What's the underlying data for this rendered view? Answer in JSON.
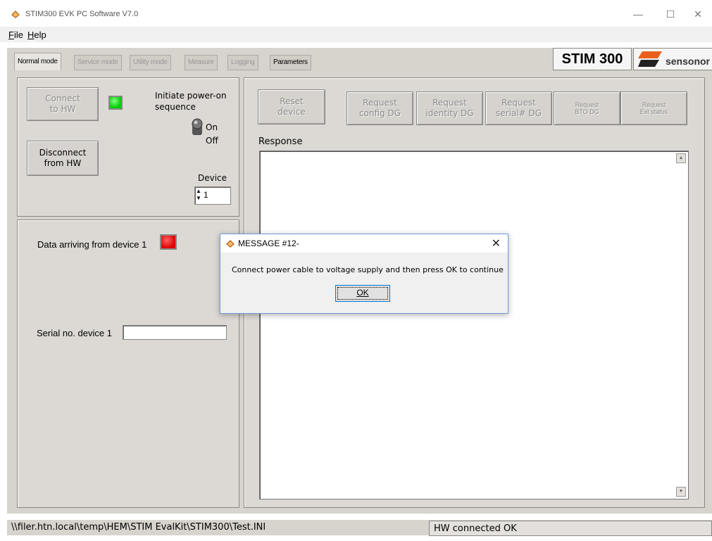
{
  "window": {
    "title": "STIM300 EVK PC Software V7.0",
    "minimize": "—",
    "maximize": "☐",
    "close": "✕"
  },
  "menu": {
    "file_first": "F",
    "file_rest": "ile",
    "help_first": "H",
    "help_rest": "elp"
  },
  "tabs": [
    "Normal mode",
    "Service mode",
    "Utility mode",
    "Measure",
    "Logging",
    "Parameters"
  ],
  "brand": {
    "product": "STIM 300",
    "company": "sensonor"
  },
  "connect_panel": {
    "connect_button": "Connect\nto HW",
    "disconnect_button": "Disconnect\nfrom HW",
    "power_label": "Initiate power-on\nsequence",
    "on_label": "On",
    "off_label": "Off",
    "device_label": "Device",
    "device_value": "1"
  },
  "data_panel": {
    "data_arriving_label": "Data arriving from device 1",
    "serial_label": "Serial no. device 1",
    "serial_value": ""
  },
  "right_panel": {
    "reset_button": "Reset\ndevice",
    "request_config": "Request\nconfig DG",
    "request_identity": "Request\nidentity DG",
    "request_serial": "Request\nserial# DG",
    "request_bto": "Request\nBTO DG",
    "request_ext": "Request\nExt status",
    "response_label": "Response",
    "response_text": ""
  },
  "status": {
    "path": "\\\\filer.htn.local\\temp\\HEM\\STIM EvalKit\\STIM300\\Test.INI",
    "hw_status": "HW connected OK"
  },
  "dialog": {
    "title": "MESSAGE #12-",
    "message": "Connect power cable to voltage supply and then press OK to continue",
    "ok_label": "OK"
  },
  "colors": {
    "frame_bg": "#d7d3cd",
    "led_green": "#00cc00",
    "led_red": "#e00000",
    "brand_orange": "#e8601c"
  },
  "icons": {
    "app": "stim-app-icon",
    "senso_logo": "sensonor-logo-icon"
  }
}
